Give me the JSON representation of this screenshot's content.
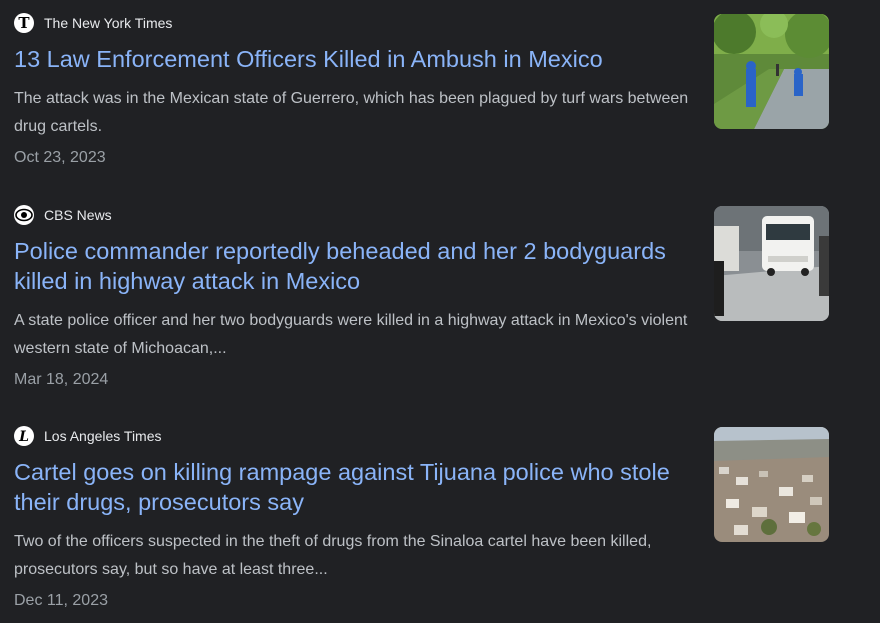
{
  "articles": [
    {
      "source": "The New York Times",
      "source_icon": "nyt-logo-icon",
      "headline": "13 Law Enforcement Officers Killed in Ambush in Mexico",
      "snippet": "The attack was in the Mexican state of Guerrero, which has been plagued by turf wars between drug cartels.",
      "date": "Oct 23, 2023",
      "thumbnail": "forensic-investigators-road-photo"
    },
    {
      "source": "CBS News",
      "source_icon": "cbs-eye-logo-icon",
      "headline": "Police commander reportedly beheaded and her 2 bodyguards killed in highway attack in Mexico",
      "snippet": "A state police officer and her two bodyguards were killed in a highway attack in Mexico's violent western state of Michoacan,...",
      "date": "Mar 18, 2024",
      "thumbnail": "white-van-highway-photo"
    },
    {
      "source": "Los Angeles Times",
      "source_icon": "la-times-logo-icon",
      "headline": "Cartel goes on killing rampage against Tijuana police who stole their drugs, prosecutors say",
      "snippet": "Two of the officers suspected in the theft of drugs from the Sinaloa cartel have been killed, prosecutors say, but so have at least three...",
      "date": "Dec 11, 2023",
      "thumbnail": "tijuana-hillside-city-photo"
    }
  ]
}
